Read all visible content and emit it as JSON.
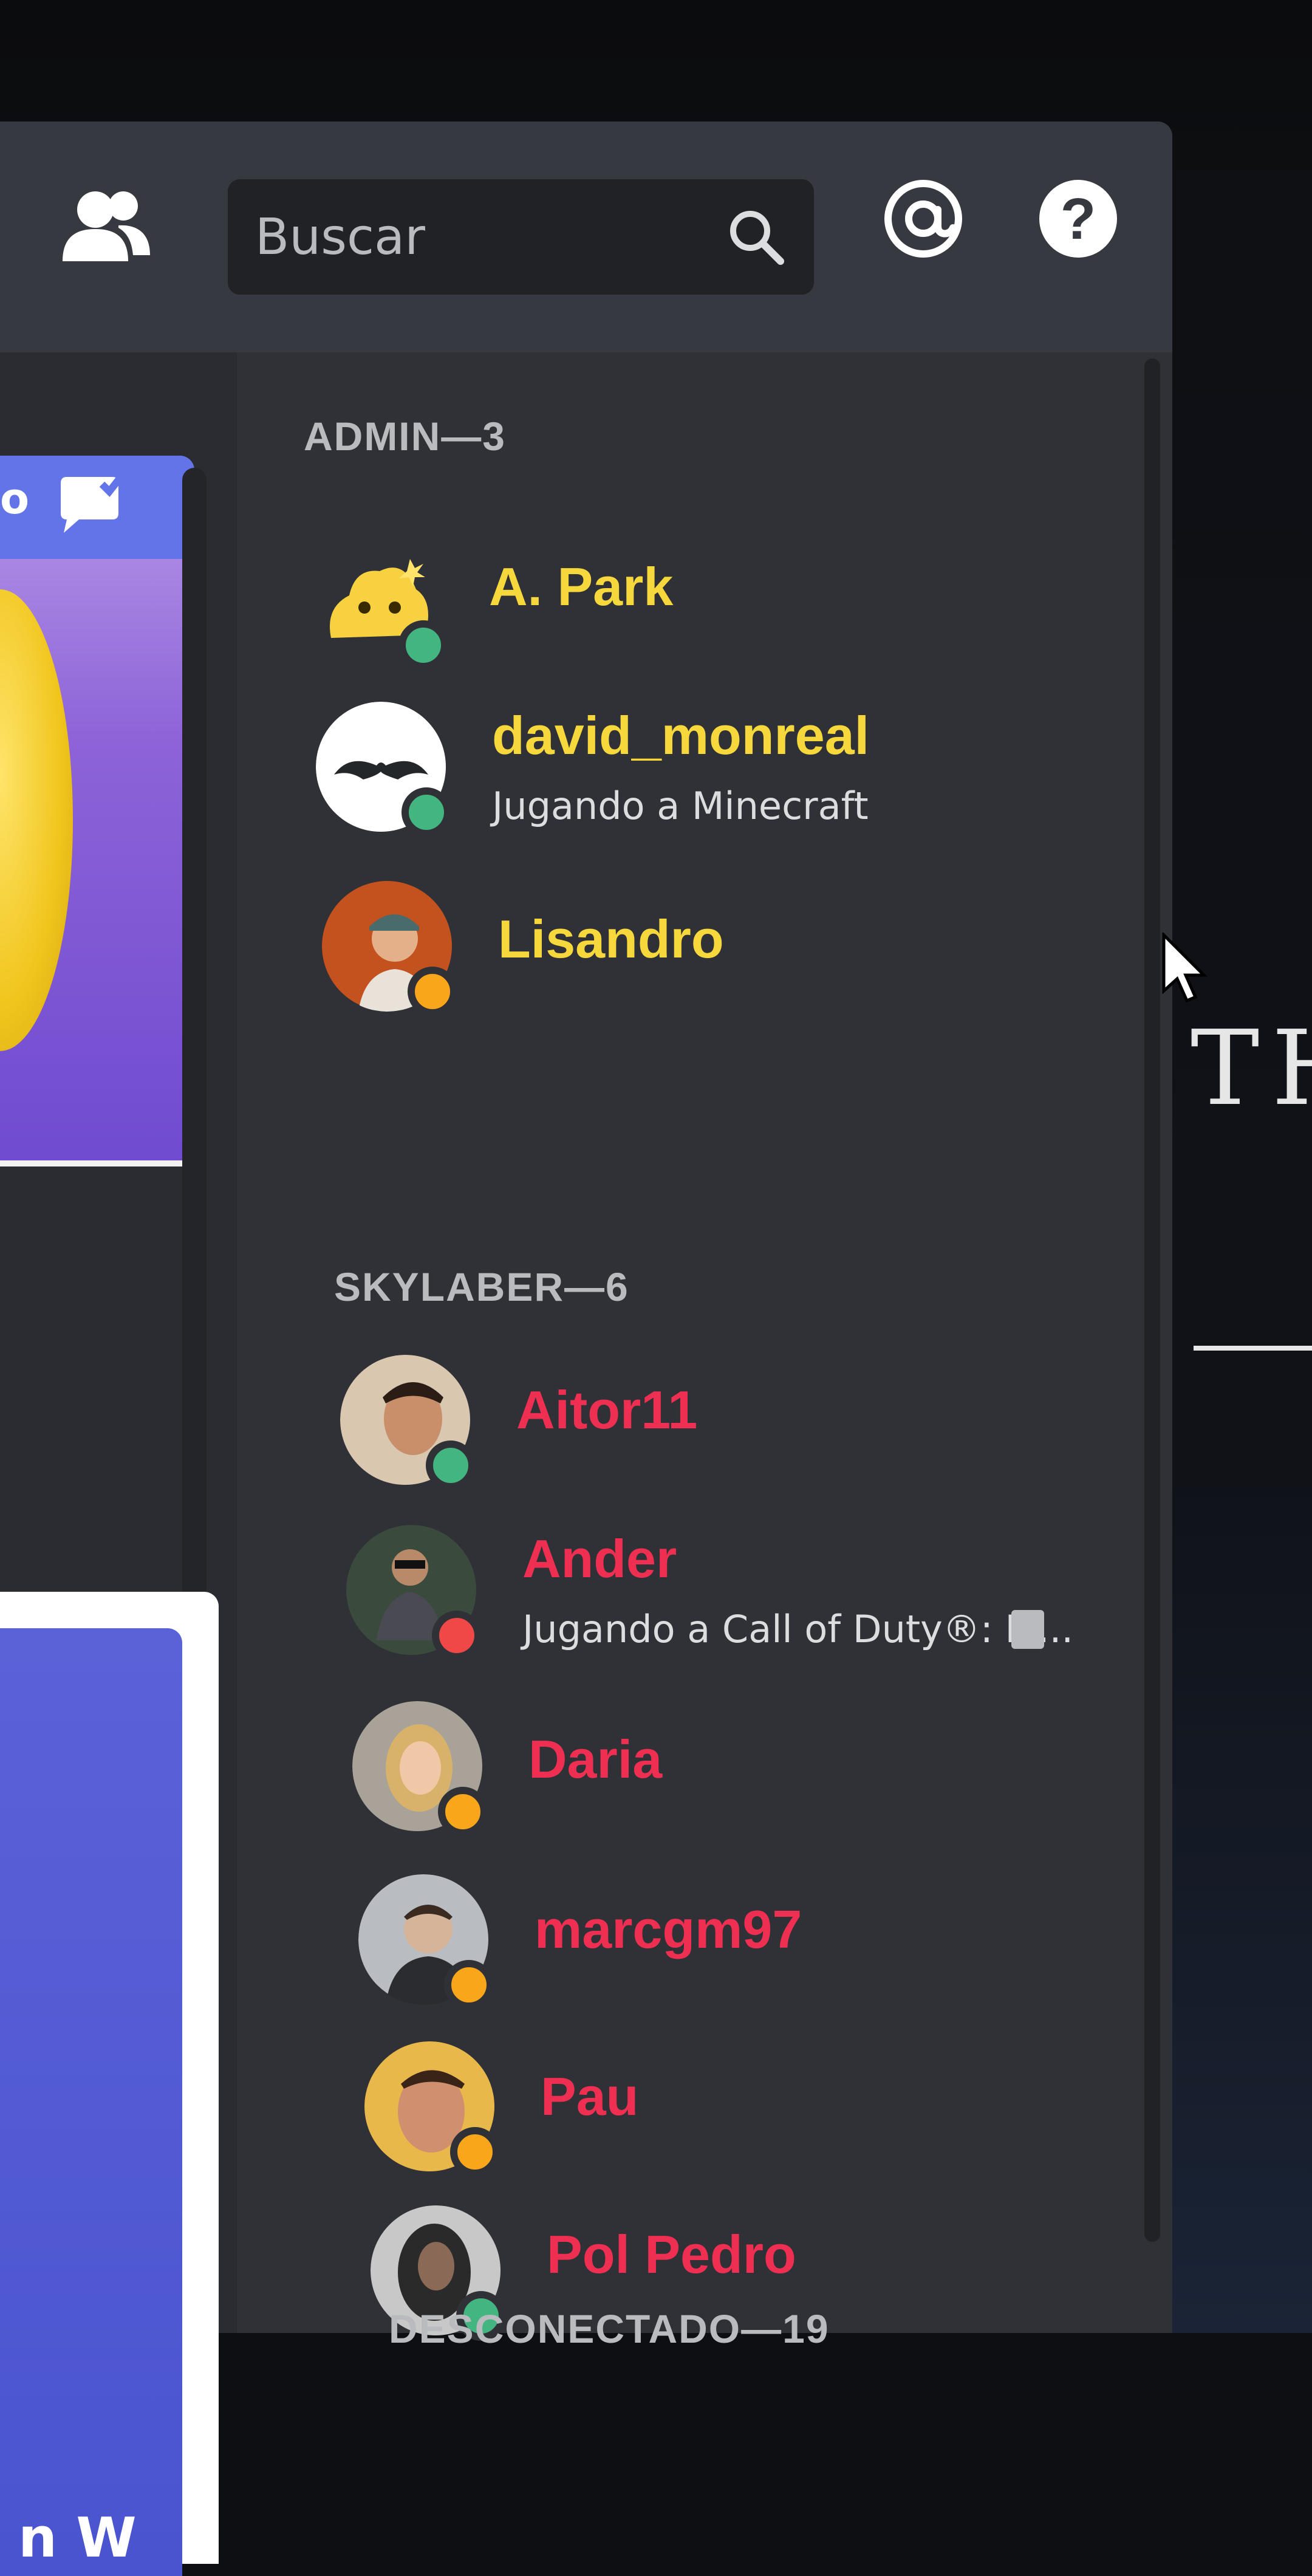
{
  "toolbar": {
    "search_placeholder": "Buscar",
    "icons": [
      "members-icon",
      "search-icon",
      "mention-icon",
      "help-icon"
    ]
  },
  "left_panel": {
    "promo_badge": "o",
    "bottom_card_text": "n W"
  },
  "member_groups": [
    {
      "header": "ADMIN—3",
      "members": [
        {
          "name": "A. Park",
          "status": "online",
          "activity": ""
        },
        {
          "name": "david_monreal",
          "status": "online",
          "activity": "Jugando a Minecraft"
        },
        {
          "name": "Lisandro",
          "status": "idle",
          "activity": ""
        }
      ]
    },
    {
      "header": "SKYLABER—6",
      "members": [
        {
          "name": "Aitor11",
          "status": "online",
          "activity": ""
        },
        {
          "name": "Ander",
          "status": "dnd",
          "activity": "Jugando a Call of Duty®: M..."
        },
        {
          "name": "Daria",
          "status": "idle",
          "activity": ""
        },
        {
          "name": "marcgm97",
          "status": "idle",
          "activity": ""
        },
        {
          "name": "Pau",
          "status": "idle",
          "activity": ""
        },
        {
          "name": "Pol Pedro",
          "status": "online",
          "activity": ""
        }
      ]
    },
    {
      "header": "DESCONECTADO—19",
      "members": []
    }
  ],
  "background": {
    "desktop_text": "TH"
  },
  "colors": {
    "admin_role": "#f7d83c",
    "skylaber_role": "#ef2f52",
    "online": "#43b581",
    "idle": "#faa61a",
    "dnd": "#f04747"
  }
}
